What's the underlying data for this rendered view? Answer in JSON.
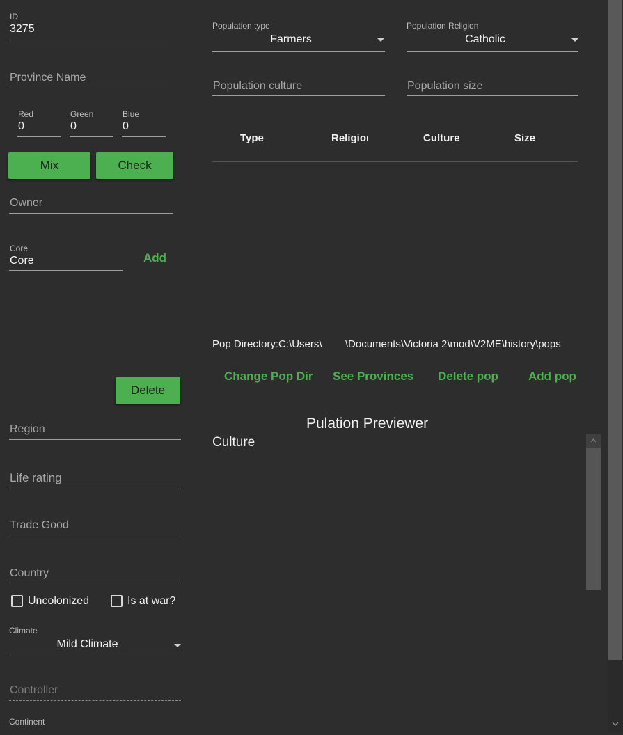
{
  "left": {
    "id": {
      "label": "ID",
      "value": "3275"
    },
    "province_name": {
      "placeholder": "Province Name"
    },
    "red": {
      "label": "Red",
      "value": "0"
    },
    "green": {
      "label": "Green",
      "value": "0"
    },
    "blue": {
      "label": "Blue",
      "value": "0"
    },
    "mix_label": "Mix",
    "check_label": "Check",
    "owner": {
      "placeholder": "Owner"
    },
    "core": {
      "label": "Core",
      "value": "Core"
    },
    "add_label": "Add",
    "delete_label": "Delete",
    "region": {
      "placeholder": "Region"
    },
    "life_rating": {
      "placeholder": "Life rating"
    },
    "trade_good": {
      "placeholder": "Trade Good"
    },
    "country": {
      "placeholder": "Country"
    },
    "uncolonized_label": "Uncolonized",
    "at_war_label": "Is at war?",
    "climate": {
      "label": "Climate",
      "value": "Mild Climate"
    },
    "controller": {
      "placeholder": "Controller"
    },
    "continent": {
      "label": "Continent"
    }
  },
  "right": {
    "pop_type": {
      "label": "Population type",
      "value": "Farmers"
    },
    "pop_religion": {
      "label": "Population Religion",
      "value": "Catholic"
    },
    "pop_culture": {
      "placeholder": "Population culture"
    },
    "pop_size": {
      "placeholder": "Population size"
    },
    "table_headers": [
      "Type",
      "Religion",
      "Culture",
      "Size"
    ],
    "pop_directory": "Pop Directory:C:\\Users\\        \\Documents\\Victoria 2\\mod\\V2ME\\history\\pops",
    "actions": {
      "change_dir": "Change Pop Dir",
      "see_provinces": "See Provinces",
      "delete_pop": "Delete pop",
      "add_pop": "Add pop"
    },
    "previewer_title": "Pulation Previewer",
    "previewer_heading": "Culture"
  },
  "colors": {
    "background": "#2d2d2d",
    "accent": "#4caf50",
    "scrollbar_track": "#3a3a3a",
    "scrollbar_thumb": "#555555"
  }
}
